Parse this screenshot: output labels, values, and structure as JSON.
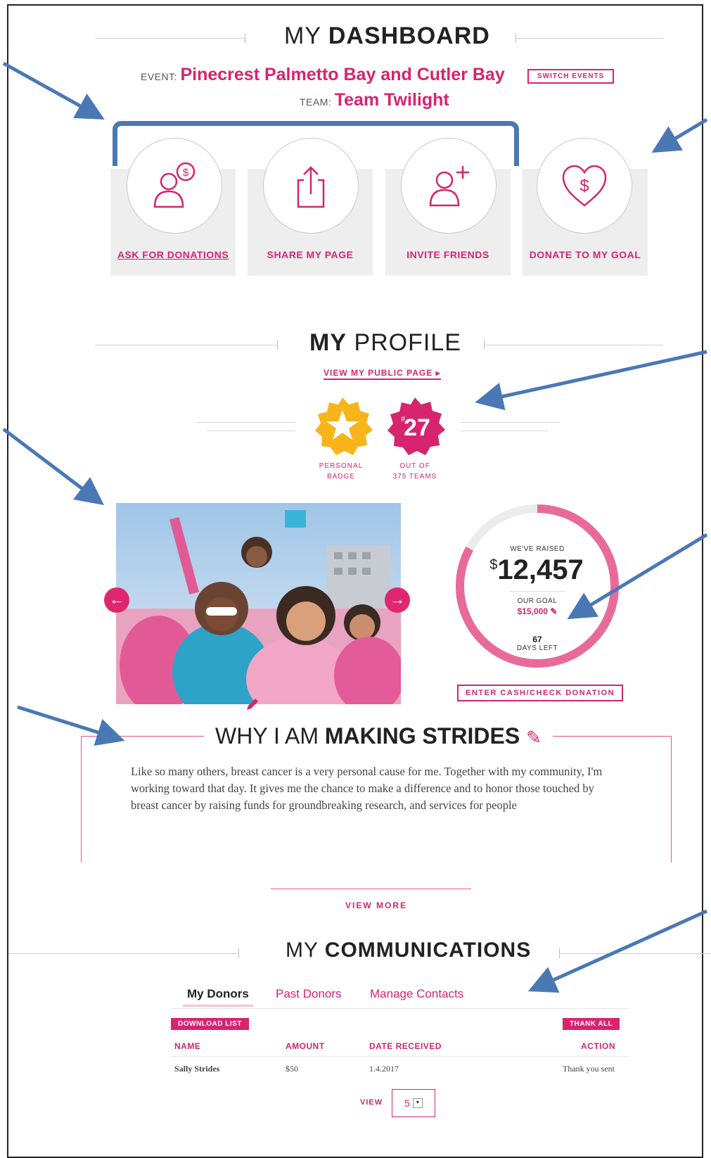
{
  "dashboard": {
    "title_light": "MY ",
    "title_bold": "DASHBOARD",
    "event_label": "EVENT:",
    "event_name": "Pinecrest Palmetto Bay and Cutler Bay",
    "switch_events": "SWITCH EVENTS",
    "team_label": "TEAM:",
    "team_name": "Team Twilight",
    "actions": [
      {
        "label": "ASK FOR DONATIONS",
        "icon": "ask-donation-icon"
      },
      {
        "label": "SHARE MY PAGE",
        "icon": "share-icon"
      },
      {
        "label": "INVITE FRIENDS",
        "icon": "invite-friend-icon"
      },
      {
        "label": "DONATE TO MY GOAL",
        "icon": "heart-dollar-icon"
      }
    ]
  },
  "profile": {
    "title_bold": "MY",
    "title_light": " PROFILE",
    "view_public": "VIEW MY PUBLIC PAGE",
    "badge1_caption_l1": "PERSONAL",
    "badge1_caption_l2": "BADGE",
    "rank_prefix": "#",
    "rank_value": "27",
    "badge2_caption_l1": "OUT OF",
    "badge2_caption_l2": "375 TEAMS"
  },
  "fundraising": {
    "raised_label": "WE'VE RAISED",
    "currency": "$",
    "raised_amount": "12,457",
    "goal_label": "OUR GOAL",
    "goal_amount": "$15,000",
    "days_left": "67",
    "days_label": "DAYS LEFT",
    "progress_fraction": 0.83,
    "enter_donation": "ENTER CASH/CHECK DONATION"
  },
  "why": {
    "title_light": "WHY I AM ",
    "title_bold": "MAKING STRIDES",
    "text": "Like so many others, breast cancer is a very personal cause for me. Together with my community, I'm working toward that day. It gives me the chance to make a difference and to honor those touched by breast cancer by raising funds for groundbreaking research, and services for people",
    "view_more": "VIEW MORE"
  },
  "communications": {
    "title_light": "MY ",
    "title_bold": "COMMUNICATIONS",
    "tabs": [
      "My Donors",
      "Past Donors",
      "Manage Contacts"
    ],
    "download_list": "DOWNLOAD LIST",
    "thank_all": "THANK ALL",
    "columns": [
      "NAME",
      "AMOUNT",
      "DATE RECEIVED",
      "ACTION"
    ],
    "rows": [
      {
        "name": "Sally Strides",
        "amount": "$50",
        "date": "1.4.2017",
        "action": "Thank you sent"
      }
    ],
    "view_label": "VIEW",
    "view_count": "5"
  },
  "colors": {
    "accent": "#d6246e",
    "arrow": "#4a78b5",
    "badge_gold": "#f7b51b"
  }
}
